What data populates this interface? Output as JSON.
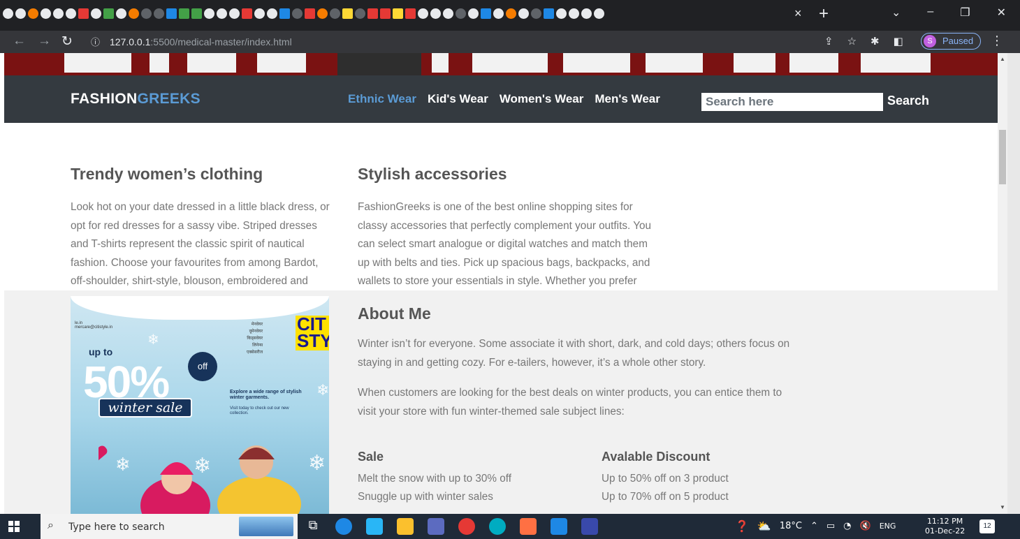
{
  "browser": {
    "url_host": "127.0.0.1",
    "url_path": ":5500/medical-master/index.html",
    "profile_initial": "S",
    "profile_status": "Paused",
    "tab_close": "×",
    "new_tab": "+"
  },
  "site": {
    "brand_main": "FASHION",
    "brand_accent": "GREEKS",
    "accent_color": "#5b9bd5",
    "navbar_color": "#343a40",
    "menu": [
      {
        "label": "Ethnic Wear",
        "active": true
      },
      {
        "label": "Kid's Wear",
        "active": false
      },
      {
        "label": "Women's Wear",
        "active": false
      },
      {
        "label": "Men's Wear",
        "active": false
      }
    ],
    "search_placeholder": "Search here",
    "search_button": "Search"
  },
  "content": {
    "women": {
      "heading": "Trendy women’s clothing",
      "lines": [
        "Look hot on your date dressed in a little black dress, or",
        "opt for red dresses for a sassy vibe. Striped dresses",
        "and T-shirts represent the classic spirit of nautical",
        "fashion. Choose your favourites from among Bardot,",
        "off-shoulder, shirt-style, blouson, embroidered and"
      ]
    },
    "accessories": {
      "heading": "Stylish accessories",
      "lines": [
        "FashionGreeks is one of the best online shopping sites for",
        "classy accessories that perfectly complement your outfits. You",
        "can select smart analogue or digital watches and match them",
        "up with belts and ties. Pick up spacious bags, backpacks, and",
        "wallets to store your essentials in style. Whether you prefer"
      ]
    },
    "about": {
      "heading": "About Me",
      "p1": [
        "Winter isn’t for everyone. Some associate it with short, dark, and cold days; others focus on",
        "staying in and getting cozy. For e-tailers, however, it’s a whole other story."
      ],
      "p2": [
        "When customers are looking for the best deals on winter products, you can entice them to",
        "visit your store with fun winter-themed sale subject lines:"
      ]
    },
    "sale": {
      "heading": "Sale",
      "items": [
        "Melt the snow with up to 30% off",
        "Snuggle up with winter sales"
      ]
    },
    "discount": {
      "heading": "Avalable Discount",
      "items": [
        "Up to 50% off on 3 product",
        "Up to 70% off on 5 product"
      ]
    },
    "promo": {
      "tiny_text": "le.in\nmercare@citistyle.in",
      "hindi_lines": [
        "मेनवेयर",
        "वूमेनवेयर",
        "किड्सवेयर",
        "लिनेन्स",
        "एक्सेसरीज"
      ],
      "logo_text": "CIT\nSTY",
      "up_to": "up to",
      "percent": "50%",
      "off": "off",
      "winter_sale": "winter sale",
      "explore": "Explore a wide range of stylish winter garments.",
      "visit": "Visit today to check out our new collection."
    }
  },
  "taskbar": {
    "search_placeholder": "Type here to search",
    "weather": "18°C",
    "language": "ENG",
    "time": "11:12 PM",
    "date": "01-Dec-22",
    "notifications": "12"
  }
}
